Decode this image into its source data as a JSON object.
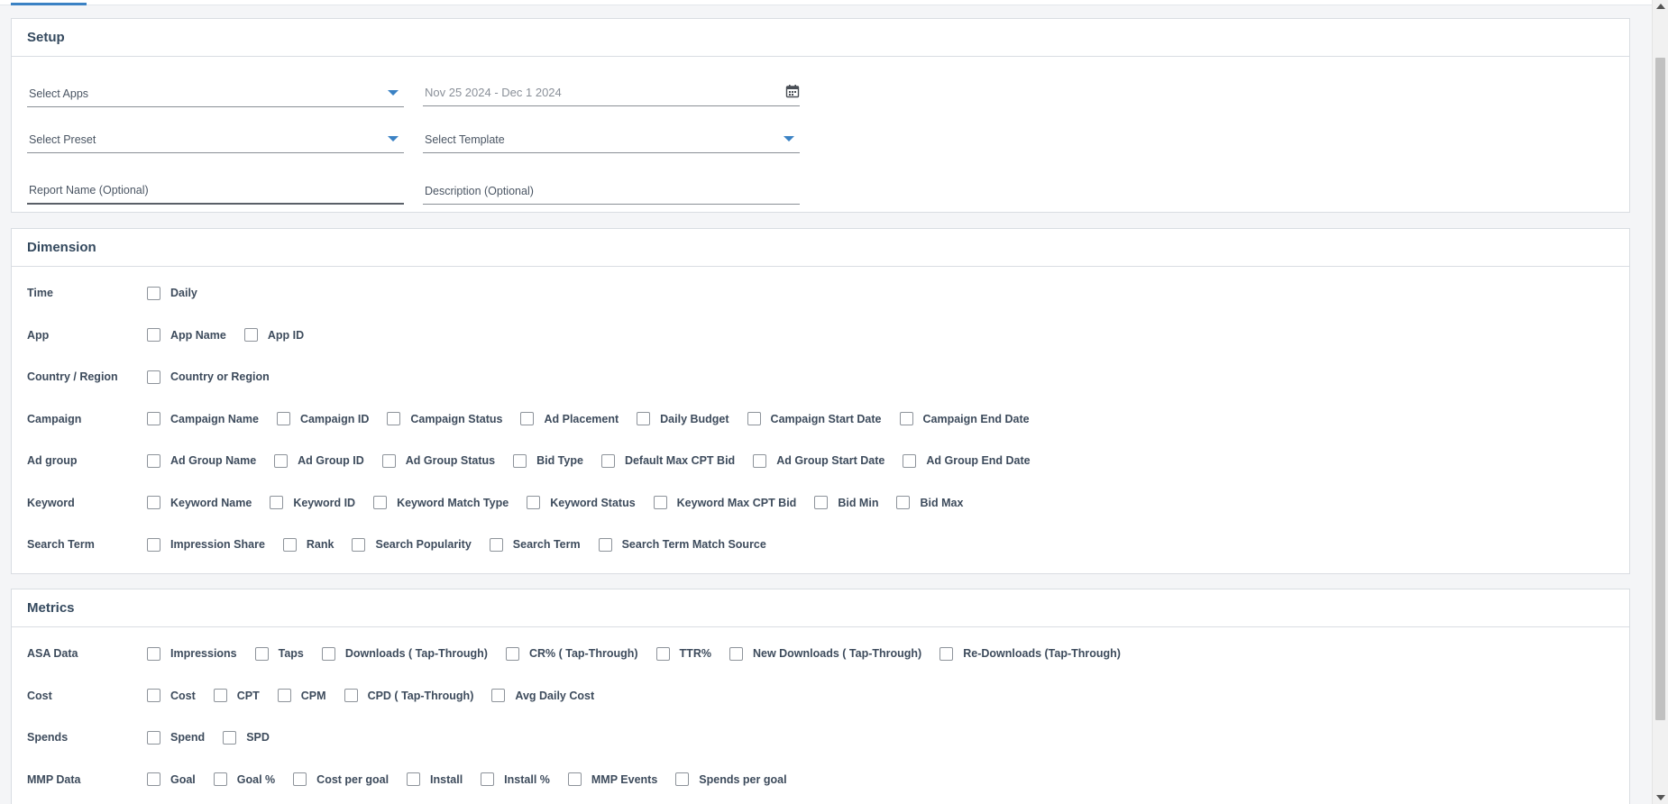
{
  "setup": {
    "title": "Setup",
    "select_apps": "Select Apps",
    "date_range": "Nov 25 2024 - Dec 1 2024",
    "select_preset": "Select Preset",
    "select_template": "Select Template",
    "report_name": "Report Name (Optional)",
    "description": "Description (Optional)"
  },
  "dimension": {
    "title": "Dimension",
    "rows": [
      {
        "label": "Time",
        "options": [
          "Daily"
        ]
      },
      {
        "label": "App",
        "options": [
          "App Name",
          "App ID"
        ]
      },
      {
        "label": "Country / Region",
        "options": [
          "Country or Region"
        ]
      },
      {
        "label": "Campaign",
        "options": [
          "Campaign Name",
          "Campaign ID",
          "Campaign Status",
          "Ad Placement",
          "Daily Budget",
          "Campaign Start Date",
          "Campaign End Date"
        ]
      },
      {
        "label": "Ad group",
        "options": [
          "Ad Group Name",
          "Ad Group ID",
          "Ad Group Status",
          "Bid Type",
          "Default Max CPT Bid",
          "Ad Group Start Date",
          "Ad Group End Date"
        ]
      },
      {
        "label": "Keyword",
        "options": [
          "Keyword Name",
          "Keyword ID",
          "Keyword Match Type",
          "Keyword Status",
          "Keyword Max CPT Bid",
          "Bid Min",
          "Bid Max"
        ]
      },
      {
        "label": "Search Term",
        "options": [
          "Impression Share",
          "Rank",
          "Search Popularity",
          "Search Term",
          "Search Term Match Source"
        ]
      }
    ]
  },
  "metrics": {
    "title": "Metrics",
    "rows": [
      {
        "label": "ASA Data",
        "options": [
          "Impressions",
          "Taps",
          "Downloads ( Tap-Through)",
          "CR% ( Tap-Through)",
          "TTR%",
          "New Downloads ( Tap-Through)",
          "Re-Downloads (Tap-Through)"
        ]
      },
      {
        "label": "Cost",
        "options": [
          "Cost",
          "CPT",
          "CPM",
          "CPD ( Tap-Through)",
          "Avg Daily Cost"
        ]
      },
      {
        "label": "Spends",
        "options": [
          "Spend",
          "SPD"
        ]
      },
      {
        "label": "MMP Data",
        "options": [
          "Goal",
          "Goal %",
          "Cost per goal",
          "Install",
          "Install %",
          "MMP Events",
          "Spends per goal"
        ]
      }
    ]
  },
  "icons": {
    "dropdown_caret": "caret-down-icon",
    "calendar": "calendar-icon"
  },
  "colors": {
    "accent": "#3b82c4"
  }
}
